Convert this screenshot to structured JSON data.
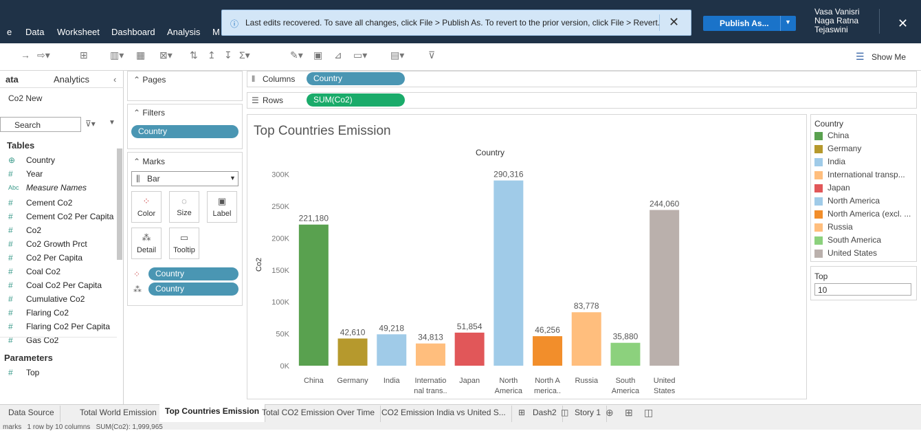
{
  "menu": [
    "e",
    "Data",
    "Worksheet",
    "Dashboard",
    "Analysis",
    "M"
  ],
  "notification": {
    "text": "Last edits recovered. To save all changes, click File > Publish As. To revert to the prior version, click File > Revert."
  },
  "publish_label": "Publish As...",
  "user": {
    "line1": "Vasa Vanisri",
    "line2": "Naga Ratna",
    "line3": "Tejaswini"
  },
  "showme_label": "Show Me",
  "left": {
    "tab_data": "ata",
    "tab_analytics": "Analytics",
    "datasource": "Co2 New",
    "search_placeholder": "Search",
    "tables_label": "Tables",
    "fields": [
      {
        "icon": "⊕",
        "name": "Country",
        "italic": false
      },
      {
        "icon": "#",
        "name": "Year",
        "italic": false
      },
      {
        "icon": "Abc",
        "name": "Measure Names",
        "italic": true
      },
      {
        "icon": "#",
        "name": "Cement Co2",
        "italic": false
      },
      {
        "icon": "#",
        "name": "Cement Co2 Per Capita",
        "italic": false
      },
      {
        "icon": "#",
        "name": "Co2",
        "italic": false
      },
      {
        "icon": "#",
        "name": "Co2 Growth Prct",
        "italic": false
      },
      {
        "icon": "#",
        "name": "Co2 Per Capita",
        "italic": false
      },
      {
        "icon": "#",
        "name": "Coal Co2",
        "italic": false
      },
      {
        "icon": "#",
        "name": "Coal Co2 Per Capita",
        "italic": false
      },
      {
        "icon": "#",
        "name": "Cumulative Co2",
        "italic": false
      },
      {
        "icon": "#",
        "name": "Flaring Co2",
        "italic": false
      },
      {
        "icon": "#",
        "name": "Flaring Co2 Per Capita",
        "italic": false
      },
      {
        "icon": "#",
        "name": "Gas Co2",
        "italic": false
      }
    ],
    "parameters_label": "Parameters",
    "parameter": "Top"
  },
  "pages_label": "Pages",
  "filters_label": "Filters",
  "filter_pill": "Country",
  "marks": {
    "label": "Marks",
    "type": "Bar",
    "buttons": [
      "Color",
      "Size",
      "Label",
      "Detail",
      "Tooltip"
    ],
    "pills": [
      "Country",
      "Country"
    ]
  },
  "shelves": {
    "columns_label": "Columns",
    "columns_pill": "Country",
    "rows_label": "Rows",
    "rows_pill": "SUM(Co2)"
  },
  "legend": {
    "title": "Country",
    "items": [
      {
        "name": "China",
        "color": "#59a14f"
      },
      {
        "name": "Germany",
        "color": "#b6992d"
      },
      {
        "name": "India",
        "color": "#a0cbe8"
      },
      {
        "name": "International transp...",
        "color": "#ffbe7d"
      },
      {
        "name": "Japan",
        "color": "#e15759"
      },
      {
        "name": "North America",
        "color": "#a0cbe8"
      },
      {
        "name": "North America (excl. ...",
        "color": "#f28e2b"
      },
      {
        "name": "Russia",
        "color": "#ffbe7d"
      },
      {
        "name": "South America",
        "color": "#8cd17d"
      },
      {
        "name": "United States",
        "color": "#bab0ac"
      }
    ]
  },
  "top_param": {
    "label": "Top",
    "value": "10"
  },
  "chart_data": {
    "type": "bar",
    "title": "Top Countries Emission",
    "header": "Country",
    "ylabel": "Co2",
    "ylim": [
      0,
      320000
    ],
    "yticks": [
      {
        "v": 0,
        "label": "0K"
      },
      {
        "v": 50000,
        "label": "50K"
      },
      {
        "v": 100000,
        "label": "100K"
      },
      {
        "v": 150000,
        "label": "150K"
      },
      {
        "v": 200000,
        "label": "200K"
      },
      {
        "v": 250000,
        "label": "250K"
      },
      {
        "v": 300000,
        "label": "300K"
      }
    ],
    "categories": [
      {
        "l1": "China",
        "l2": ""
      },
      {
        "l1": "Germany",
        "l2": ""
      },
      {
        "l1": "India",
        "l2": ""
      },
      {
        "l1": "Internatio",
        "l2": "nal trans.."
      },
      {
        "l1": "Japan",
        "l2": ""
      },
      {
        "l1": "North",
        "l2": "America"
      },
      {
        "l1": "North A",
        "l2": "merica.."
      },
      {
        "l1": "Russia",
        "l2": ""
      },
      {
        "l1": "South",
        "l2": "America"
      },
      {
        "l1": "United",
        "l2": "States"
      }
    ],
    "values": [
      221180,
      42610,
      49218,
      34813,
      51854,
      290316,
      46256,
      83778,
      35880,
      244060
    ],
    "value_labels": [
      "221,180",
      "42,610",
      "49,218",
      "34,813",
      "51,854",
      "290,316",
      "46,256",
      "83,778",
      "35,880",
      "244,060"
    ],
    "colors": [
      "#59a14f",
      "#b6992d",
      "#a0cbe8",
      "#ffbe7d",
      "#e15759",
      "#a0cbe8",
      "#f28e2b",
      "#ffbe7d",
      "#8cd17d",
      "#bab0ac"
    ]
  },
  "tabs": [
    "Data Source",
    "Total World Emission",
    "Top Countries Emission",
    "Total CO2 Emission Over Time",
    "CO2 Emission India vs United S...",
    "Dash2",
    "Story 1"
  ],
  "status_text": "marks   1 row by 10 columns   SUM(Co2): 1,999,965"
}
